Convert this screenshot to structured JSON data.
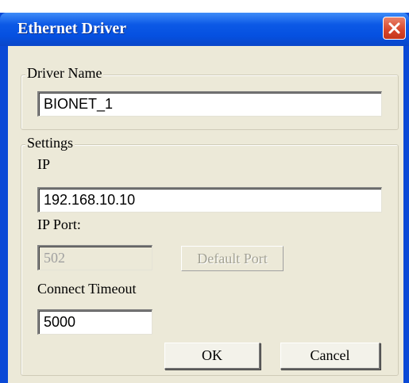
{
  "window": {
    "title": "Ethernet Driver"
  },
  "driver_group": {
    "label": "Driver Name",
    "name_value": "BIONET_1"
  },
  "settings_group": {
    "label": "Settings",
    "ip_label": "IP",
    "ip_value": "192.168.10.10",
    "port_label": "IP Port:",
    "port_value": "502",
    "default_port_label": "Default Port",
    "timeout_label": "Connect Timeout",
    "timeout_value": "5000"
  },
  "buttons": {
    "ok_label": "OK",
    "cancel_label": "Cancel"
  },
  "icons": {
    "close": "close-icon"
  },
  "colors": {
    "titlebar": "#0550e0",
    "close_button": "#d6452a",
    "dialog_background": "#ece9d8"
  }
}
